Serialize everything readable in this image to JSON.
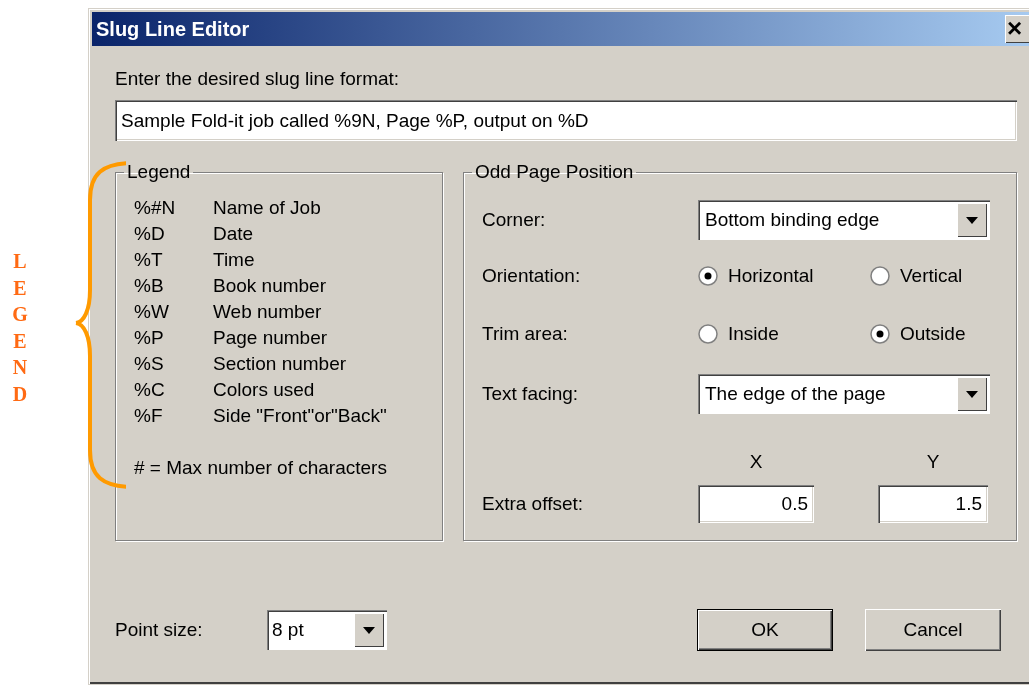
{
  "annotation": {
    "label": "LEGEND"
  },
  "window": {
    "title": "Slug Line Editor",
    "close": "×"
  },
  "format": {
    "label": "Enter the desired slug line format:",
    "value": "Sample Fold-it job called %9N, Page %P, output on %D"
  },
  "legend": {
    "title": "Legend",
    "items": [
      {
        "code": "%#N",
        "meaning": "Name of Job"
      },
      {
        "code": "%D",
        "meaning": "Date"
      },
      {
        "code": "%T",
        "meaning": "Time"
      },
      {
        "code": "%B",
        "meaning": "Book number"
      },
      {
        "code": "%W",
        "meaning": "Web number"
      },
      {
        "code": "%P",
        "meaning": "Page number"
      },
      {
        "code": "%S",
        "meaning": "Section number"
      },
      {
        "code": "%C",
        "meaning": "Colors used"
      },
      {
        "code": "%F",
        "meaning": "Side \"Front\"or\"Back\""
      }
    ],
    "note": "# = Max number of characters"
  },
  "odd_page_position": {
    "title": "Odd Page Position",
    "rows": [
      {
        "kind": "dropdown",
        "label": "Corner:",
        "value": "Bottom binding edge"
      },
      {
        "kind": "radio",
        "label": "Orientation:",
        "options": [
          {
            "label": "Horizontal",
            "selected": true
          },
          {
            "label": "Vertical",
            "selected": false
          }
        ]
      },
      {
        "kind": "radio",
        "label": "Trim area:",
        "options": [
          {
            "label": "Inside",
            "selected": false
          },
          {
            "label": "Outside",
            "selected": true
          }
        ]
      },
      {
        "kind": "dropdown",
        "label": "Text facing:",
        "value": "The edge of the page"
      },
      {
        "kind": "offset",
        "label": "Extra offset:",
        "fields": [
          {
            "heading": "X",
            "value": "0.5"
          },
          {
            "heading": "Y",
            "value": "1.5"
          }
        ]
      }
    ]
  },
  "point_size": {
    "label": "Point size:",
    "value": "8 pt"
  },
  "buttons": [
    {
      "label": "OK",
      "default": true
    },
    {
      "label": "Cancel",
      "default": false
    }
  ]
}
